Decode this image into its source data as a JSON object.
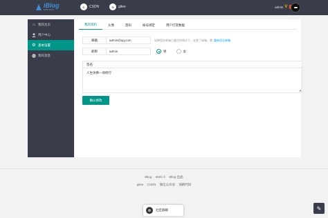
{
  "topbar": {
    "logo_name": "iBlog",
    "logo_sub": "BOB DUN",
    "nav": [
      {
        "icon": "C",
        "label": "CSDN"
      },
      {
        "icon": "G",
        "label": "gitee"
      }
    ],
    "user_name": "admin",
    "v_mark": "V",
    "vip_badge": "VIP"
  },
  "sidebar": {
    "items": [
      {
        "icon": "home-icon",
        "label": "我的主页",
        "active": false
      },
      {
        "icon": "user-icon",
        "label": "用户中心",
        "active": false
      },
      {
        "icon": "gear-icon",
        "label": "基本设置",
        "active": true
      },
      {
        "icon": "chat-icon",
        "label": "我的消息",
        "active": false
      }
    ]
  },
  "tabs": [
    "我的资料",
    "头像",
    "密码",
    "帐号绑定",
    "用户打赏数据"
  ],
  "form": {
    "email_label": "邮箱",
    "email_value": "admin@qq.com",
    "email_hint": "如果您在邮箱已激活的情况下，变更了邮箱，需",
    "email_hint_link": "重新验证邮箱",
    "nick_label": "昵称",
    "nick_value": "admin",
    "gender_male": "男",
    "gender_female": "女",
    "sign_label": "签名",
    "sign_value": "人生仿佛一场修行",
    "submit": "确认修改"
  },
  "footer": {
    "line1": [
      "iBlog",
      "2022 ©",
      "iBlog 出品"
    ],
    "line2": [
      "gitee",
      "CSDN",
      "微信公众号",
      "加群代码"
    ]
  },
  "community": "社区群聊",
  "colors": {
    "accent": "#009688",
    "dark": "#393d49",
    "link": "#01aaed",
    "vip": "#e8542c"
  }
}
